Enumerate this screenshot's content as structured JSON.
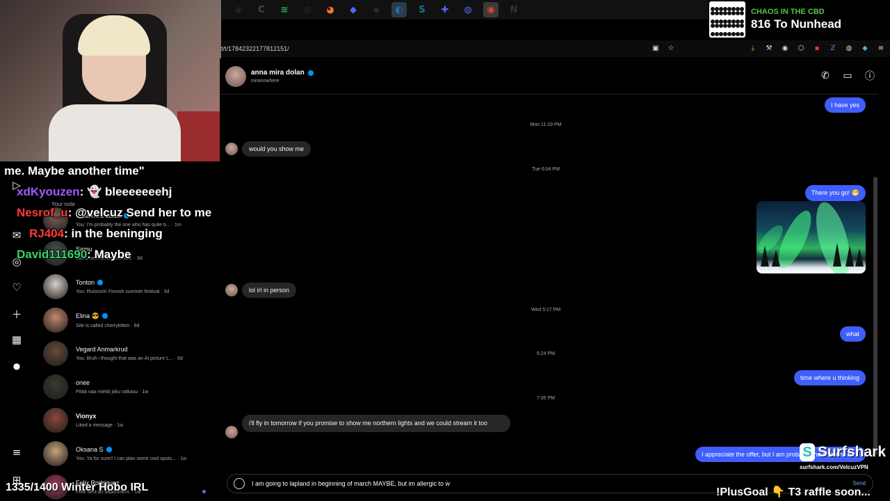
{
  "taskbar": {
    "icons": [
      {
        "name": "steam-icon",
        "glyph": "◉",
        "color": "#1b2838"
      },
      {
        "name": "ccleaner-icon",
        "glyph": "C",
        "color": "#3d4a5a"
      },
      {
        "name": "spotify-icon",
        "glyph": "≋",
        "color": "#1db954"
      },
      {
        "name": "obs-icon",
        "glyph": "◎",
        "color": "#302e31"
      },
      {
        "name": "firefox-icon",
        "glyph": "◕",
        "color": "#ff7139"
      },
      {
        "name": "streamlabs-icon",
        "glyph": "◆",
        "color": "#4a6cf7"
      },
      {
        "name": "shield-app-icon",
        "glyph": "◈",
        "color": "#333"
      },
      {
        "name": "browser-icon",
        "glyph": "◐",
        "color": "#2b6cb0"
      },
      {
        "name": "streamdeck-icon",
        "glyph": "S",
        "color": "#0f7a8a"
      },
      {
        "name": "gamepad-icon",
        "glyph": "✚",
        "color": "#5865f2"
      },
      {
        "name": "discord-icon",
        "glyph": "◍",
        "color": "#5865f2"
      },
      {
        "name": "chrome-icon",
        "glyph": "◉",
        "color": "#ea4335"
      },
      {
        "name": "notion-icon",
        "glyph": "N",
        "color": "#333"
      }
    ]
  },
  "browser": {
    "url": "t/t/17842322177812151/"
  },
  "alert": {
    "subtitle": "CHAOS IN THE CBD",
    "title": "816 To Nunhead"
  },
  "stream_chat": {
    "lines": [
      {
        "text": "me. Maybe another time\""
      },
      {
        "user": "xdKyouzen",
        "sep": ":",
        "msg": "👻 bleeeeeeehj",
        "color": "#9b5cff"
      },
      {
        "user": "Nesrof_u",
        "sep": ":",
        "msg": "@velcuz Send her to me",
        "color": "#ff3a3a"
      },
      {
        "user": "RJ404",
        "sep": ":",
        "msg": "in the beninging",
        "color": "#ff3a3a"
      },
      {
        "user": "David111690",
        "sep": ":",
        "msg": "Maybe",
        "color": "#39d26b"
      }
    ],
    "goal": "1335/1400 Winter Hobo IRL"
  },
  "inbox": {
    "your_note": "Your note",
    "conversations": [
      {
        "name": "anna mira dolan",
        "verified": true,
        "bold": false,
        "sub": "You: I'm probably the one who has quite b... · 1m",
        "avatar_color": "#7a5f57"
      },
      {
        "name": "Samu",
        "verified": false,
        "bold": false,
        "sub": "Samu sent an attachment. · 3d",
        "avatar_color": "#4b4e55"
      },
      {
        "name": "Tonton",
        "verified": true,
        "bold": false,
        "sub": "You: Ruisrock! Finnish summer festival · 3d",
        "avatar_color": "#d9d0c9"
      },
      {
        "name": "Elina 😎",
        "verified": true,
        "bold": false,
        "sub": "Site is called cherrykitten · 6d",
        "avatar_color": "#c4876e"
      },
      {
        "name": "Vegard Anmarkrud",
        "verified": false,
        "bold": false,
        "sub": "You: Bruh i thought that was an AI picture L... · 6d",
        "avatar_color": "#6b4a3b"
      },
      {
        "name": "onee",
        "verified": false,
        "bold": false,
        "sub": "Pitää vaa miettii joku ratkasu · 1w",
        "avatar_color": "#3a3a30"
      },
      {
        "name": "Vionyx",
        "verified": false,
        "bold": true,
        "sub": "Liked a message · 1w",
        "avatar_color": "#8a4a3a"
      },
      {
        "name": "Oksana S",
        "verified": true,
        "bold": false,
        "sub": "You: Ya for sure!! I can plan some cool spots... · 1w",
        "avatar_color": "#c9a27a"
      },
      {
        "name": "Felix Rodriguez",
        "verified": false,
        "bold": false,
        "sub": "Felix sent an attachment. · 1w",
        "avatar_color": "#9a3a5a"
      }
    ]
  },
  "sidebar": {
    "icons": [
      "reels-icon",
      "messages-icon",
      "explore-icon",
      "notifications-icon",
      "create-icon",
      "dashboard-icon",
      "profile-icon",
      "menu-icon",
      "more-icon"
    ]
  },
  "chat": {
    "contact_name": "anna mira dolan",
    "contact_username": "miranowhere",
    "messages": {
      "m1": "I have yes",
      "ts1": "Mon 11:19 PM",
      "m2": "would you show me",
      "ts2": "Tue 6:04 PM",
      "m3": "There you go! 😁",
      "m4": "lol irl in person",
      "ts3": "Wed 5:17 PM",
      "m5": "what",
      "ts4": "6:24 PM",
      "m6": "time where u thinking",
      "ts5": "7:35 PM",
      "m7": "i'll fly in tomorrow if you promise to show me northern lights and we could stream it too",
      "m8": "I appreciate the offer, but I am probably the one who has quite b..."
    },
    "composer_text": "I am going to lapland in beginning of march MAYBE, but im allergic to w",
    "send_label": "Send"
  },
  "sponsor": {
    "name": "Surfshark",
    "url": "surfshark.com/VelcuzVPN"
  },
  "plus_goal": "!PlusGoal 👇 T3 raffle soon..."
}
